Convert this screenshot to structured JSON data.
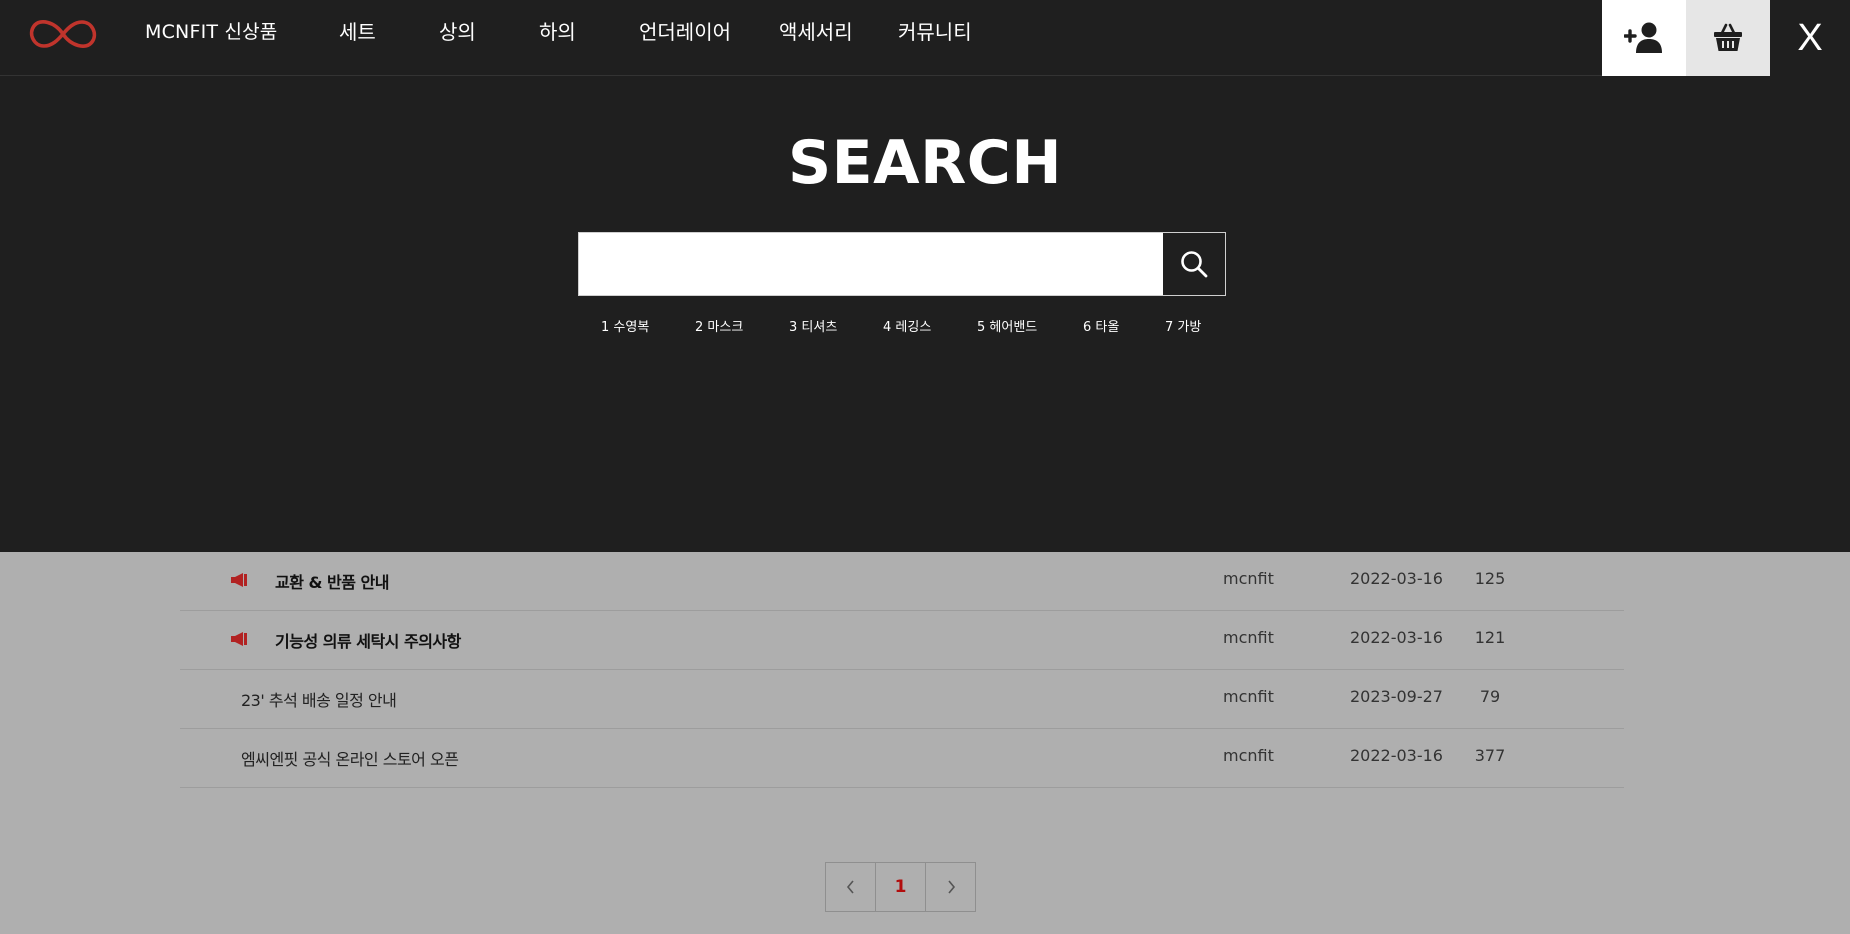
{
  "header": {
    "brand": "MCNFIT 신상품",
    "nav": [
      "세트",
      "상의",
      "하의",
      "언더레이어",
      "액세서리",
      "커뮤니티"
    ],
    "close_label": "X",
    "colors": {
      "bar": "#1f1f1f",
      "logo_red": "#c0342c"
    },
    "icons": {
      "join": "person-plus-icon",
      "cart": "basket-icon"
    }
  },
  "search": {
    "title": "SEARCH",
    "input_value": "",
    "input_placeholder": "",
    "button_icon": "search-icon",
    "popular_keywords": [
      "1 수영복",
      "2 마스크",
      "3 티셔츠",
      "4 레깅스",
      "5 헤어밴드",
      "6 타올",
      "7 가방"
    ]
  },
  "board": {
    "rows": [
      {
        "notice": true,
        "subject": "교환 & 반품 안내",
        "writer": "mcnfit",
        "date": "2022-03-16",
        "hits": "125"
      },
      {
        "notice": true,
        "subject": "기능성 의류 세탁시 주의사항",
        "writer": "mcnfit",
        "date": "2022-03-16",
        "hits": "121"
      },
      {
        "notice": false,
        "subject": "23' 추석 배송 일정 안내",
        "writer": "mcnfit",
        "date": "2023-09-27",
        "hits": "79"
      },
      {
        "notice": false,
        "subject": "엠씨엔핏 공식 온라인 스토어 오픈",
        "writer": "mcnfit",
        "date": "2022-03-16",
        "hits": "377"
      }
    ],
    "pagination": {
      "prev_icon": "chevron-left-icon",
      "current": "1",
      "next_icon": "chevron-right-icon"
    }
  }
}
